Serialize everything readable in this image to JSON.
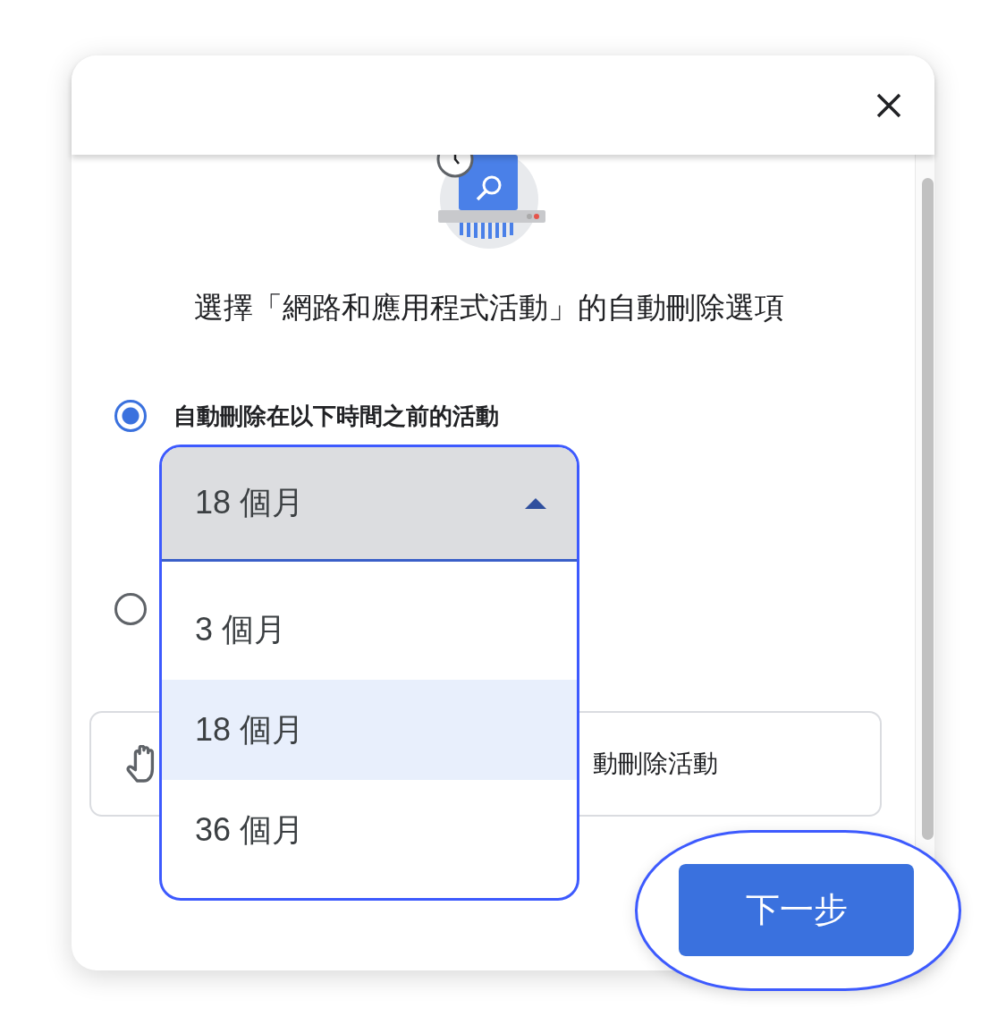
{
  "dialog": {
    "title": "選擇「網路和應用程式活動」的自動刪除選項",
    "options": [
      {
        "label": "自動刪除在以下時間之前的活動",
        "selected": true
      },
      {
        "selected": false
      }
    ],
    "dropdown": {
      "value": "18 個月",
      "expanded": true,
      "options": [
        {
          "label": "3 個月",
          "selected": false
        },
        {
          "label": "18 個月",
          "selected": true
        },
        {
          "label": "36 個月",
          "selected": false
        }
      ]
    },
    "info": {
      "text": "動刪除活動"
    },
    "next_button": {
      "label": "下一步",
      "highlighted": true
    }
  }
}
